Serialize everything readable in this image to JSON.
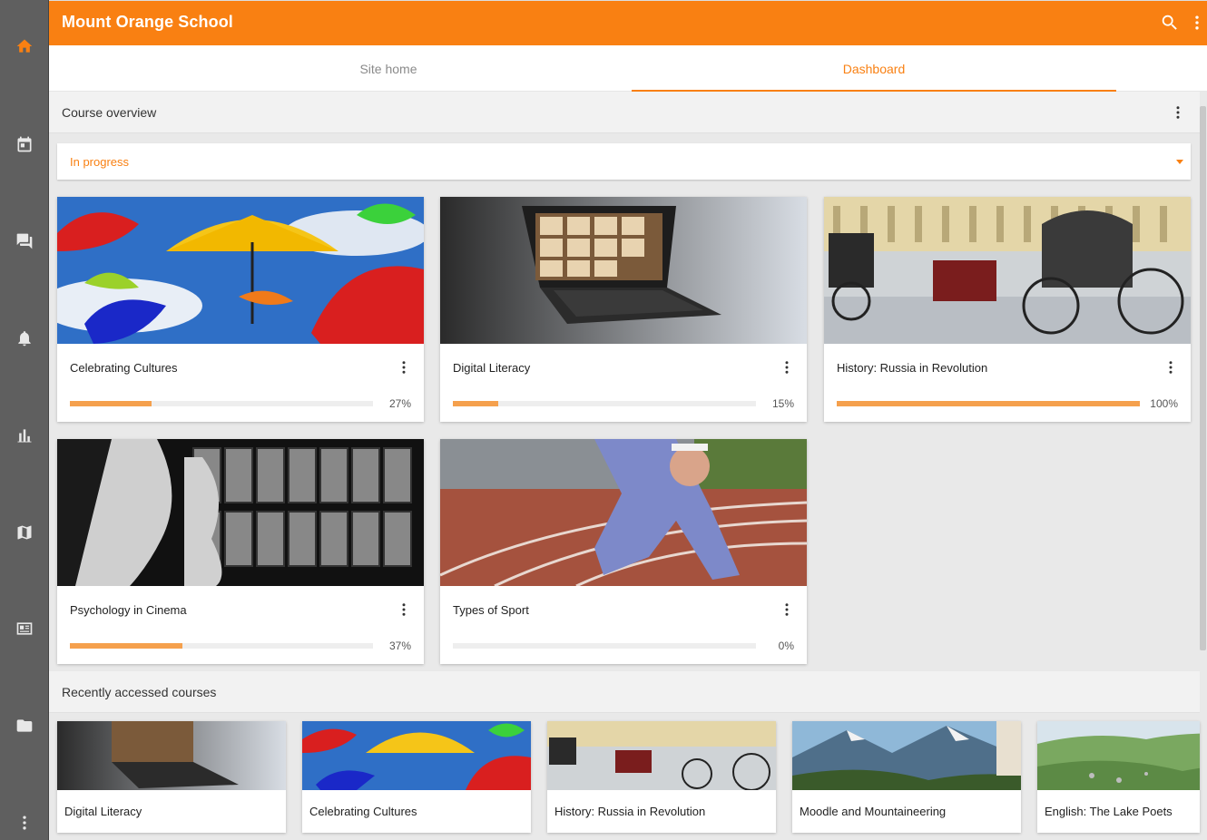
{
  "app": {
    "title": "Mount Orange School"
  },
  "colors": {
    "brand": "#f98012",
    "sidebar": "#5f5f5f",
    "progress": "#f5a04d"
  },
  "sidebar": {
    "items": [
      {
        "icon": "home-icon"
      },
      {
        "icon": "calendar-icon"
      },
      {
        "icon": "messages-icon"
      },
      {
        "icon": "notifications-bell-icon"
      },
      {
        "icon": "grades-chart-icon"
      },
      {
        "icon": "map-icon"
      },
      {
        "icon": "news-icon"
      },
      {
        "icon": "folder-icon"
      },
      {
        "icon": "more-vertical-icon"
      }
    ]
  },
  "header": {
    "icons": [
      "search-icon",
      "more-vertical-icon"
    ]
  },
  "tabs": [
    {
      "label": "Site home",
      "active": false
    },
    {
      "label": "Dashboard",
      "active": true
    }
  ],
  "course_overview": {
    "label": "Course overview",
    "filter_value": "In progress",
    "courses": [
      {
        "name": "Celebrating Cultures",
        "progress": 27,
        "progress_label": "27%"
      },
      {
        "name": "Digital Literacy",
        "progress": 15,
        "progress_label": "15%"
      },
      {
        "name": "History: Russia in Revolution",
        "progress": 100,
        "progress_label": "100%"
      },
      {
        "name": "Psychology in Cinema",
        "progress": 37,
        "progress_label": "37%"
      },
      {
        "name": "Types of Sport",
        "progress": 0,
        "progress_label": "0%"
      }
    ]
  },
  "recent": {
    "label": "Recently accessed courses",
    "courses": [
      {
        "name": "Digital Literacy"
      },
      {
        "name": "Celebrating Cultures"
      },
      {
        "name": "History: Russia in Revolution"
      },
      {
        "name": "Moodle and Mountaineering"
      },
      {
        "name": "English: The Lake Poets"
      }
    ]
  }
}
